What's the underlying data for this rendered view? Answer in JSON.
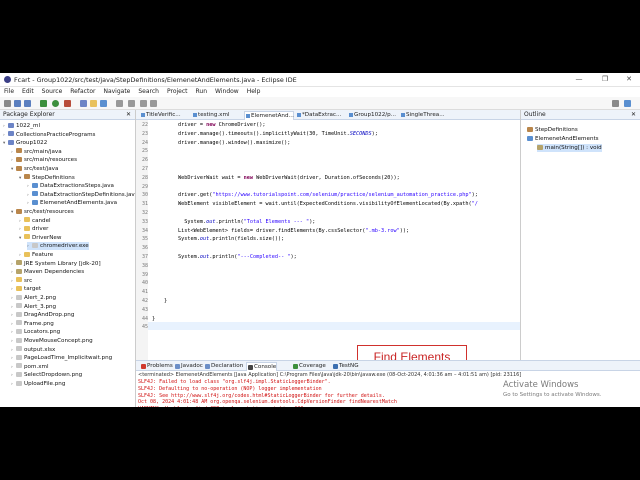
{
  "window": {
    "title": "Fcart - Group1022/src/test/java/StepDefinitions/ElemenetAndElements.java - Eclipse IDE",
    "controls": {
      "minimize": "—",
      "maximize": "❐",
      "close": "✕"
    }
  },
  "menu": [
    "File",
    "Edit",
    "Source",
    "Refactor",
    "Navigate",
    "Search",
    "Project",
    "Run",
    "Window",
    "Help"
  ],
  "explorer": {
    "tab_label": "Package Explorer",
    "items": [
      {
        "label": "1022_ml",
        "depth": 0,
        "icon": "project"
      },
      {
        "label": "CollectionsPracticePrograms",
        "depth": 0,
        "icon": "project"
      },
      {
        "label": "Group1022",
        "depth": 0,
        "icon": "project",
        "expanded": true
      },
      {
        "label": "src/main/java",
        "depth": 1,
        "icon": "package-folder"
      },
      {
        "label": "src/main/resources",
        "depth": 1,
        "icon": "package-folder"
      },
      {
        "label": "src/test/java",
        "depth": 1,
        "icon": "package-folder",
        "expanded": true
      },
      {
        "label": "StepDefinitions",
        "depth": 2,
        "icon": "package",
        "expanded": true
      },
      {
        "label": "DataExtractionsSteps.java",
        "depth": 3,
        "icon": "java"
      },
      {
        "label": "DataExtractionStepDefinitions.java",
        "depth": 3,
        "icon": "java"
      },
      {
        "label": "ElemenetAndElements.java",
        "depth": 3,
        "icon": "java"
      },
      {
        "label": "src/test/resources",
        "depth": 1,
        "icon": "package-folder",
        "expanded": true
      },
      {
        "label": "candel",
        "depth": 2,
        "icon": "folder"
      },
      {
        "label": "driver",
        "depth": 2,
        "icon": "folder"
      },
      {
        "label": "DriverNew",
        "depth": 2,
        "icon": "folder",
        "expanded": true
      },
      {
        "label": "chromedriver.exe",
        "depth": 3,
        "icon": "file",
        "selected": true
      },
      {
        "label": "Feature",
        "depth": 2,
        "icon": "folder"
      },
      {
        "label": "JRE System Library [jdk-20]",
        "depth": 1,
        "icon": "library"
      },
      {
        "label": "Maven Dependencies",
        "depth": 1,
        "icon": "library"
      },
      {
        "label": "src",
        "depth": 1,
        "icon": "folder"
      },
      {
        "label": "target",
        "depth": 1,
        "icon": "folder"
      },
      {
        "label": "Alert_2.png",
        "depth": 1,
        "icon": "file"
      },
      {
        "label": "Alert_3.png",
        "depth": 1,
        "icon": "file"
      },
      {
        "label": "DragAndDrop.png",
        "depth": 1,
        "icon": "file"
      },
      {
        "label": "Frame.png",
        "depth": 1,
        "icon": "file"
      },
      {
        "label": "Locators.png",
        "depth": 1,
        "icon": "file"
      },
      {
        "label": "MoveMouseConcept.png",
        "depth": 1,
        "icon": "file"
      },
      {
        "label": "output.xlsx",
        "depth": 1,
        "icon": "file"
      },
      {
        "label": "PageLoadTime_Implicitwait.png",
        "depth": 1,
        "icon": "file"
      },
      {
        "label": "pom.xml",
        "depth": 1,
        "icon": "file"
      },
      {
        "label": "SelectDropdown.png",
        "depth": 1,
        "icon": "file"
      },
      {
        "label": "UploadFile.png",
        "depth": 1,
        "icon": "file"
      }
    ]
  },
  "editor": {
    "tabs": [
      "TitleVerific...",
      "testing.xml",
      "ElemenetAnd...",
      "*DataExtrac...",
      "Group1022/p...",
      "SingleThrea..."
    ],
    "active_tab": 2,
    "lines": [
      {
        "no": "22",
        "code": "driver = new ChromeDriver();"
      },
      {
        "no": "23",
        "code": "driver.manage().timeouts().implicitlyWait(30, TimeUnit.SECONDS);"
      },
      {
        "no": "24",
        "code": "driver.manage().window().maximize();"
      },
      {
        "no": "25",
        "code": ""
      },
      {
        "no": "26",
        "code": ""
      },
      {
        "no": "27",
        "code": ""
      },
      {
        "no": "28",
        "code": "WebDriverWait wait = new WebDriverWait(driver, Duration.ofSeconds(20));"
      },
      {
        "no": "29",
        "code": ""
      },
      {
        "no": "30",
        "code": "driver.get(\"https://www.tutorialspoint.com/selenium/practice/selenium_automation_practice.php\");"
      },
      {
        "no": "31",
        "code": "WebElement visibleElement = wait.until(ExpectedConditions.visibilityOfElementLocated(By.xpath(\"/"
      },
      {
        "no": "32",
        "code": ""
      },
      {
        "no": "33",
        "code": "  System.out.println(\"Total Elements --- \");"
      },
      {
        "no": "34",
        "code": "List<WebElement> fields= driver.findElements(By.cssSelector(\".mb-3.row\"));"
      },
      {
        "no": "35",
        "code": "System.out.println(fields.size());"
      },
      {
        "no": "36",
        "code": ""
      },
      {
        "no": "37",
        "code": "System.out.println(\"---Completed-- \");"
      },
      {
        "no": "38",
        "code": ""
      },
      {
        "no": "39",
        "code": ""
      },
      {
        "no": "40",
        "code": ""
      },
      {
        "no": "41",
        "code": ""
      },
      {
        "no": "42",
        "code": "}"
      },
      {
        "no": "43",
        "code": ""
      },
      {
        "no": "44",
        "code": "}"
      },
      {
        "no": "45",
        "code": ""
      }
    ],
    "annotation": "Find Elements"
  },
  "outline": {
    "tab_label": "Outline",
    "items": [
      {
        "label": "StepDefinitions",
        "depth": 0
      },
      {
        "label": "ElemenetAndElements",
        "depth": 0
      },
      {
        "label": "main(String[]) : void",
        "depth": 1
      }
    ]
  },
  "console": {
    "tabs": [
      "Problems",
      "Javadoc",
      "Declaration",
      "Console",
      "Coverage",
      "TestNG"
    ],
    "active_tab": 3,
    "header": "<terminated> ElemenetAndElements [Java Application] C:\\Program Files\\Java\\jdk-20\\bin\\javaw.exe  (08-Oct-2024, 4:01:36 am – 4:01:51 am) [pid: 23116]",
    "lines": [
      {
        "text": "SLF4J: Failed to load class \"org.slf4j.impl.StaticLoggerBinder\".",
        "kind": "err"
      },
      {
        "text": "SLF4J: Defaulting to no-operation (NOP) logger implementation",
        "kind": "err"
      },
      {
        "text": "SLF4J: See http://www.slf4j.org/codes.html#StaticLoggerBinder for further details.",
        "kind": "err"
      },
      {
        "text": "Oct 08, 2024 4:01:48 AM org.openqa.selenium.devtools.CdpVersionFinder findNearestMatch",
        "kind": "err"
      },
      {
        "text": "WARNING: Unable to find CDP implementation matching 129",
        "kind": "err"
      },
      {
        "text": "Oct 08, 2024 4:01:48 AM org.openqa.selenium.chromium.ChromiumDriver lambda$new$5",
        "kind": "err"
      },
      {
        "text": "WARNING: Unable to find version of CDP to use for 129.0.6668.60. You may need to include a dependency on a specific version of the CDP using something",
        "kind": "err"
      },
      {
        "text": "Total Elements ---",
        "kind": "out"
      },
      {
        "text": "10",
        "kind": "out"
      },
      {
        "text": "---Completed--",
        "kind": "out"
      }
    ]
  },
  "watermark": {
    "line1": "Activate Windows",
    "line2": "Go to Settings to activate Windows."
  }
}
